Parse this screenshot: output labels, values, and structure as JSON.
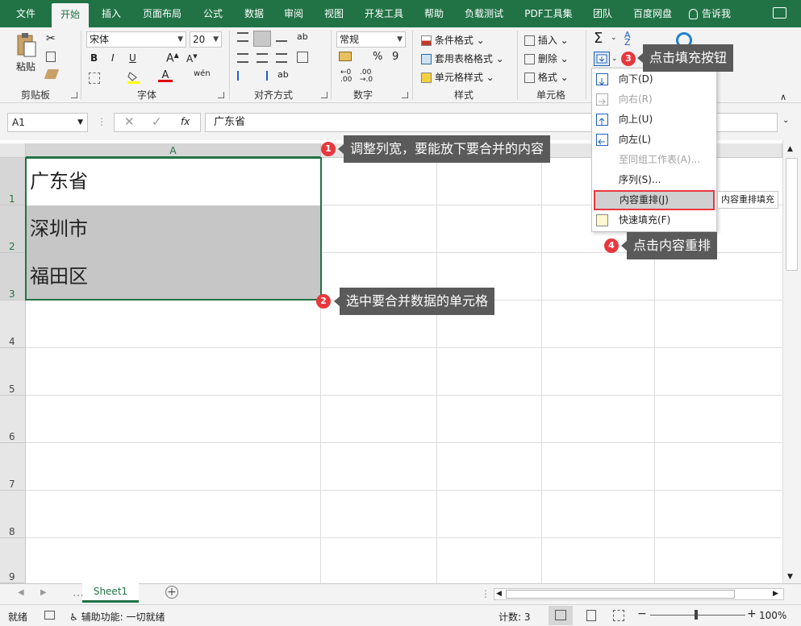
{
  "ribbon_tabs": [
    "文件",
    "开始",
    "插入",
    "页面布局",
    "公式",
    "数据",
    "审阅",
    "视图",
    "开发工具",
    "帮助",
    "负载测试",
    "PDF工具集",
    "团队",
    "百度网盘",
    "告诉我"
  ],
  "clipboard": {
    "paste": "粘贴",
    "label": "剪贴板"
  },
  "font": {
    "name": "宋体",
    "size": "20",
    "label": "字体",
    "bold": "B",
    "italic": "I",
    "underline": "U"
  },
  "align": {
    "label": "对齐方式"
  },
  "number": {
    "format": "常规",
    "percent": "%",
    "comma": "9",
    "label": "数字"
  },
  "styles": {
    "cond": "条件格式",
    "table": "套用表格格式",
    "cell": "单元格样式",
    "label": "样式"
  },
  "cells": {
    "insert": "插入",
    "delete": "删除",
    "format": "格式",
    "label": "单元格"
  },
  "formula_bar": {
    "name_box": "A1",
    "fx": "fx",
    "content": "广东省"
  },
  "grid": {
    "col_a": "A",
    "rows": [
      "1",
      "2",
      "3",
      "4",
      "5",
      "6",
      "7",
      "8",
      "9"
    ],
    "cells": [
      "广东省",
      "深圳市",
      "福田区"
    ]
  },
  "fill_menu": {
    "items": [
      "向下(D)",
      "向右(R)",
      "向上(U)",
      "向左(L)",
      "至同组工作表(A)...",
      "序列(S)...",
      "内容重排(J)",
      "快速填充(F)"
    ],
    "tooltip": "内容重排填充"
  },
  "callouts": {
    "c1": {
      "num": "1",
      "text": "调整列宽，要能放下要合并的内容"
    },
    "c2": {
      "num": "2",
      "text": "选中要合并数据的单元格"
    },
    "c3": {
      "num": "3",
      "text": "点击填充按钮"
    },
    "c4": {
      "num": "4",
      "text": "点击内容重排"
    }
  },
  "sheet_tab": "Sheet1",
  "status": {
    "ready": "就绪",
    "accessibility": "辅助功能: 一切就绪",
    "count": "计数: 3",
    "zoom": "100%"
  },
  "colors": {
    "accent": "#217346",
    "selection": "#c6c6c6",
    "highlight_border": "#e8383d"
  }
}
